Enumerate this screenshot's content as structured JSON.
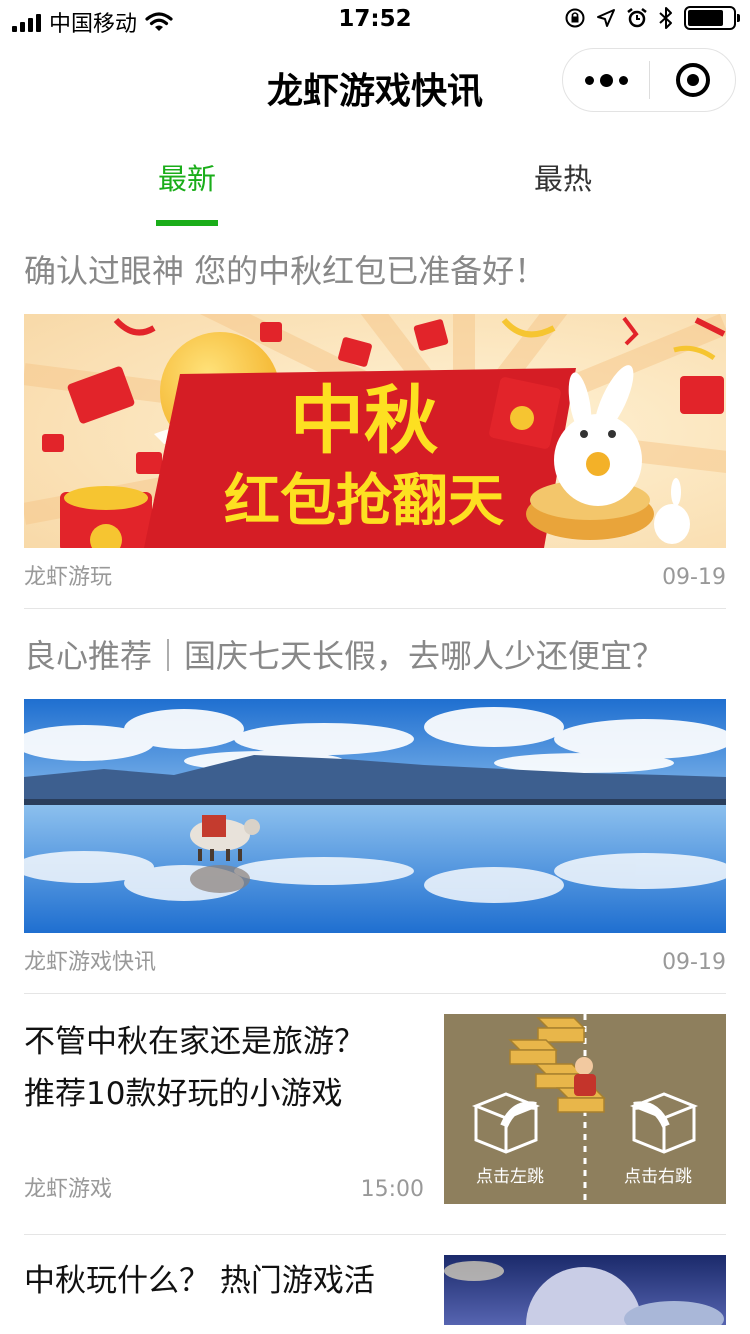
{
  "status_bar": {
    "carrier": "中国移动",
    "time": "17:52",
    "battery_level": 0.8
  },
  "nav": {
    "title": "龙虾游戏快讯"
  },
  "tabs": [
    {
      "label": "最新",
      "active": true
    },
    {
      "label": "最热",
      "active": false
    }
  ],
  "accent_color": "#1aad19",
  "articles": [
    {
      "title": "确认过眼神 您的中秋红包已准备好！",
      "banner_text_1": "中秋",
      "banner_text_2": "红包抢翻天",
      "source": "龙虾游玩",
      "date": "09-19"
    },
    {
      "title": "良心推荐｜国庆七天长假，去哪人少还便宜？",
      "source": "龙虾游戏快讯",
      "date": "09-19"
    },
    {
      "title_line_1": "不管中秋在家还是旅游？",
      "title_line_2": "推荐10款好玩的小游戏",
      "thumb_left_label": "点击左跳",
      "thumb_right_label": "点击右跳",
      "source": "龙虾游戏",
      "date": "15:00"
    },
    {
      "title_line_1": "中秋玩什么？ 热门游戏活"
    }
  ]
}
